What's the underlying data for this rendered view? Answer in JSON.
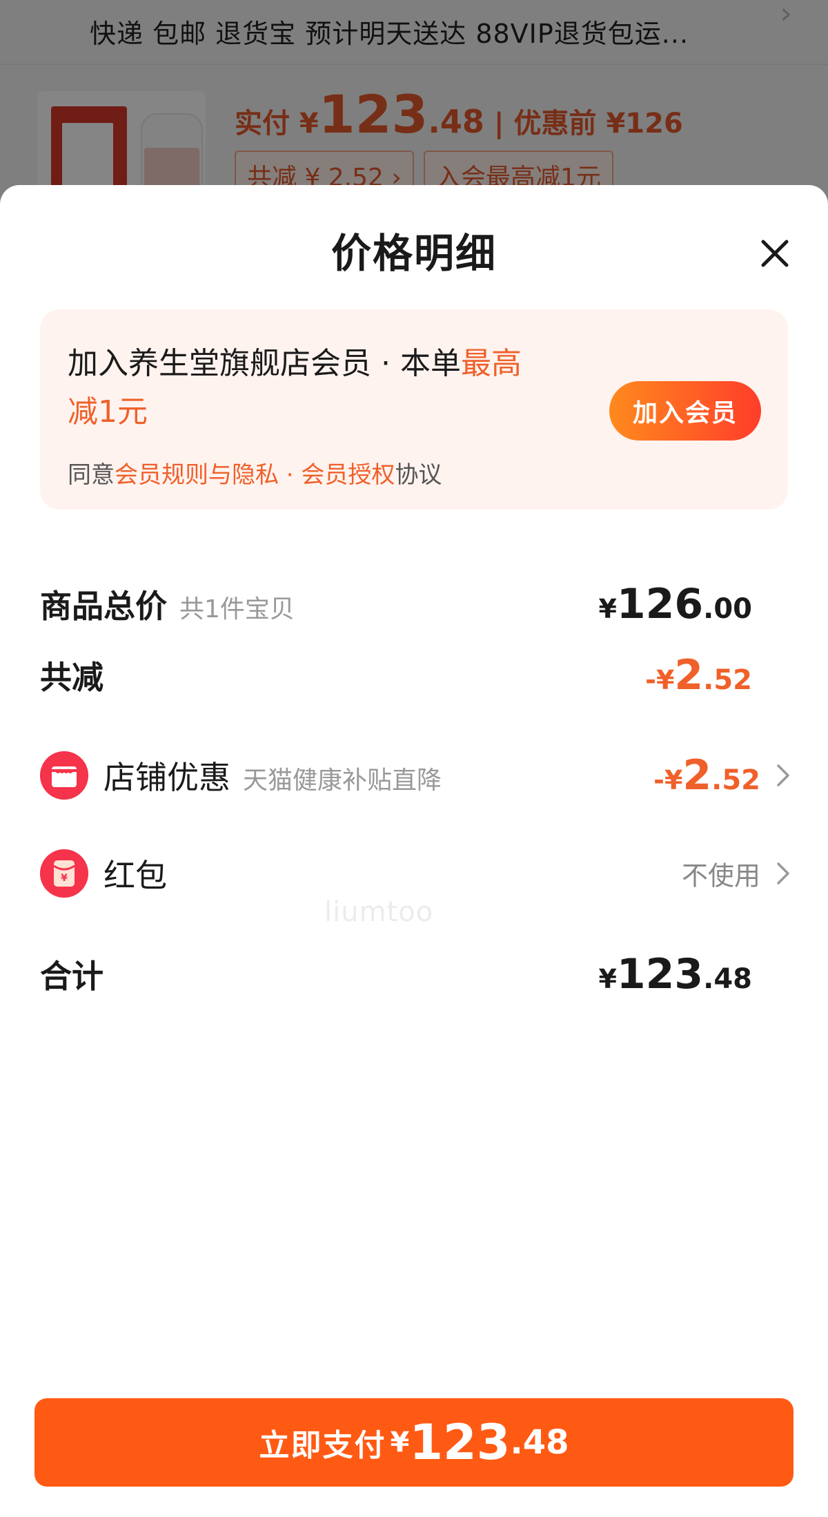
{
  "background": {
    "delivery_line": "快递 包邮 退货宝 预计明天送达 88VIP退货包运...",
    "price_label": "实付 ¥",
    "price_integer": "123",
    "price_decimal": ".48",
    "original_price": "优惠前 ¥126",
    "discount_chip": "共减 ¥ 2.52 ›",
    "member_chip": "入会最高减1元"
  },
  "sheet": {
    "title": "价格明细"
  },
  "member_card": {
    "line1": "加入养生堂旗舰店会员 · 本单",
    "highlight_a": "最高",
    "highlight_b": "减1元",
    "agree_prefix": "同意",
    "agree_link": "会员规则与隐私 · 会员授权",
    "agree_suffix": "协议",
    "join_button": "加入会员"
  },
  "rows": {
    "total": {
      "label": "商品总价",
      "sub": "共1件宝贝",
      "currency": "¥",
      "integer": "126",
      "decimal": ".00"
    },
    "reduction": {
      "label": "共减",
      "prefix": "-¥",
      "integer": "2",
      "decimal": ".52"
    },
    "store_discount": {
      "label": "店铺优惠",
      "sub": "天猫健康补贴直降",
      "prefix": "-¥",
      "integer": "2",
      "decimal": ".52",
      "icon": "store-icon"
    },
    "red_packet": {
      "label": "红包",
      "value": "不使用",
      "icon": "red-packet-icon"
    },
    "sum": {
      "label": "合计",
      "currency": "¥",
      "integer": "123",
      "decimal": ".48"
    }
  },
  "watermark": "liumtoo",
  "pay_button": {
    "label": "立即支付",
    "currency": "¥",
    "integer": "123",
    "decimal": ".48"
  },
  "colors": {
    "accent": "#f0602a",
    "pay_button": "#ff5a14",
    "member_card_bg": "#fff3ef",
    "store_icon": "#f5334a"
  }
}
